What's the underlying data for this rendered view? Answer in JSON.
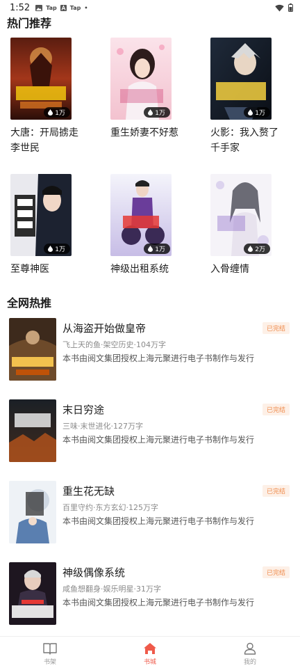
{
  "status_bar": {
    "time": "1:52",
    "left_icons": [
      {
        "name": "gallery-icon",
        "label": ""
      },
      {
        "name": "tap-icon",
        "label": "Tap"
      },
      {
        "name": "app-a-icon",
        "label": ""
      },
      {
        "name": "tap-icon-2",
        "label": "Tap"
      },
      {
        "name": "dot-icon",
        "label": "•"
      }
    ]
  },
  "hot_section": {
    "title": "热门推荐",
    "books": [
      {
        "title": "大唐：开局掳走李世民",
        "badge": "1万"
      },
      {
        "title": "重生娇妻不好惹",
        "badge": "1万"
      },
      {
        "title": "火影：我入赘了千手家",
        "badge": "1万"
      },
      {
        "title": "至尊神医",
        "badge": "1万"
      },
      {
        "title": "神级出租系统",
        "badge": "1万"
      },
      {
        "title": "入骨缠情",
        "badge": "2万"
      }
    ]
  },
  "network_section": {
    "title": "全网热推",
    "items": [
      {
        "title": "从海盗开始做皇帝",
        "meta": "飞上天的鱼·架空历史·104万字",
        "desc": "本书由阅文集团授权上海元聚进行电子书制作与发行",
        "status": "已完结"
      },
      {
        "title": "末日穷途",
        "meta": "三味·末世进化·127万字",
        "desc": "本书由阅文集团授权上海元聚进行电子书制作与发行",
        "status": "已完结"
      },
      {
        "title": "重生花无缺",
        "meta": "百里守约·东方玄幻·125万字",
        "desc": "本书由阅文集团授权上海元聚进行电子书制作与发行",
        "status": "已完结"
      },
      {
        "title": "神级偶像系统",
        "meta": "咸鱼想翻身·娱乐明星·31万字",
        "desc": "本书由阅文集团授权上海元聚进行电子书制作与发行",
        "status": "已完结"
      }
    ]
  },
  "bottom_nav": {
    "items": [
      {
        "label": "书架",
        "icon": "book-icon"
      },
      {
        "label": "书城",
        "icon": "home-icon"
      },
      {
        "label": "我的",
        "icon": "user-icon"
      }
    ],
    "active_index": 1
  },
  "colors": {
    "accent": "#ef5a4a",
    "status_tag_text": "#ef8a4a",
    "status_tag_bg": "#fdf0e7"
  }
}
